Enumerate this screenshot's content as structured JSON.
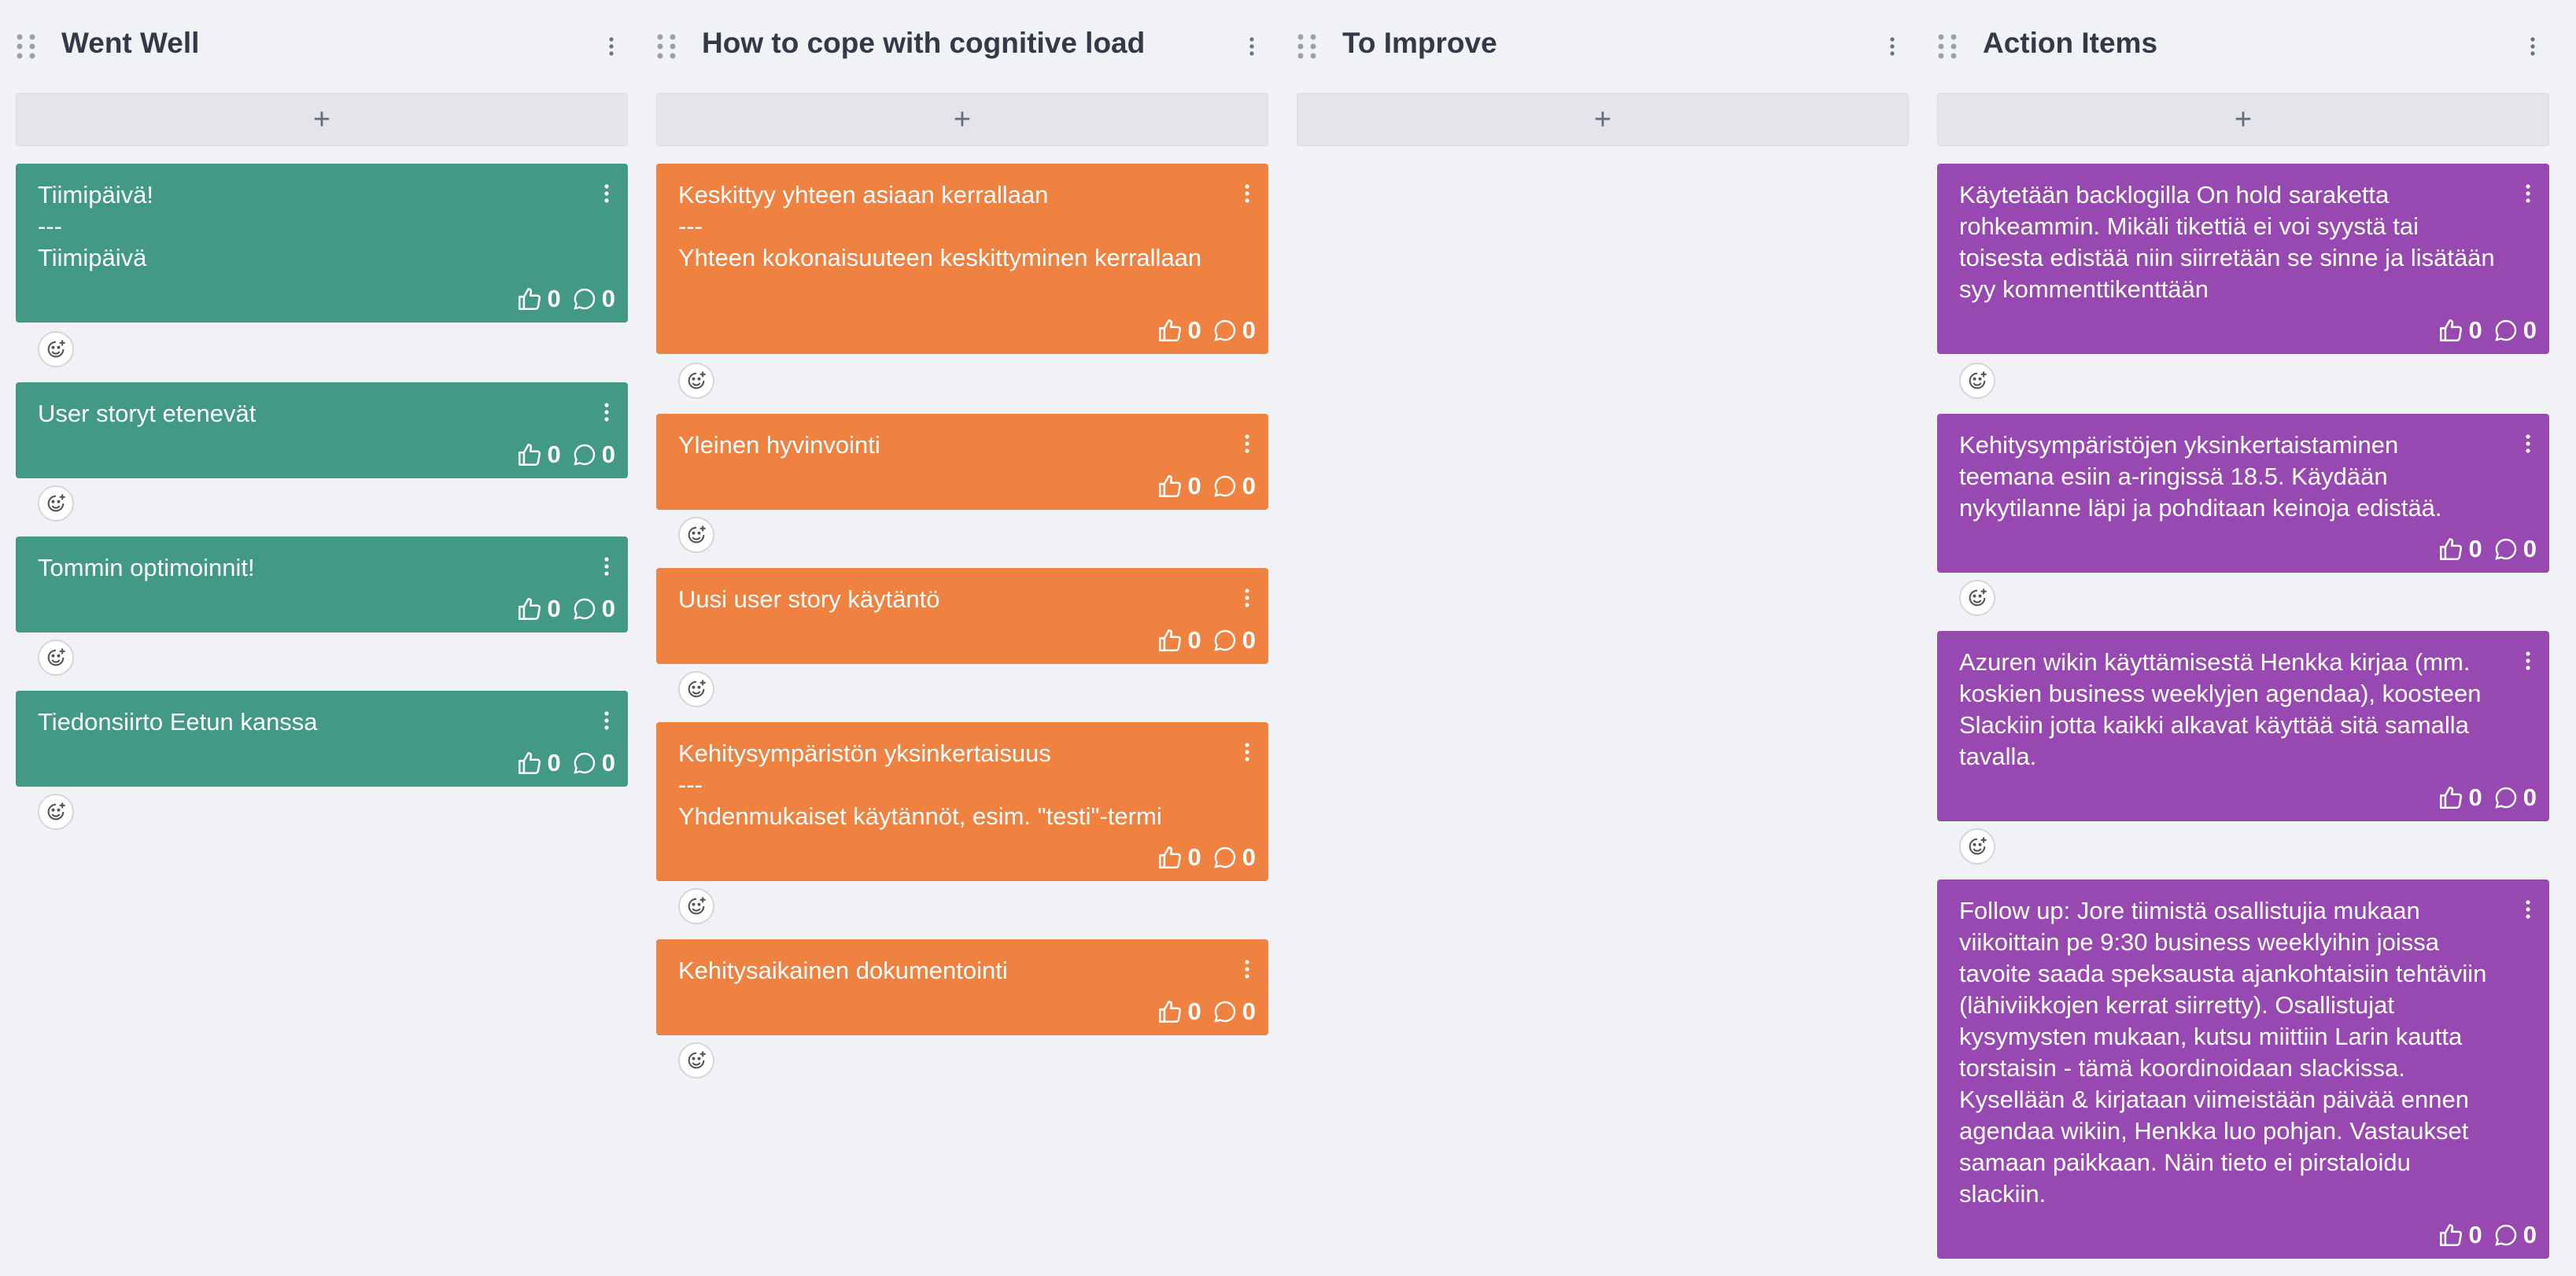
{
  "columns": [
    {
      "title": "Went Well",
      "add_label": "+",
      "color": "#419986",
      "cards": [
        {
          "text": "Tiimipäivä!\n---\nTiimipäivä",
          "likes": "0",
          "comments": "0"
        },
        {
          "text": "User storyt etenevät",
          "likes": "0",
          "comments": "0"
        },
        {
          "text": "Tommin optimoinnit!",
          "likes": "0",
          "comments": "0"
        },
        {
          "text": "Tiedonsiirto Eetun kanssa",
          "likes": "0",
          "comments": "0"
        }
      ]
    },
    {
      "title": "How to cope with cognitive load",
      "add_label": "+",
      "color": "#ef8141",
      "cards": [
        {
          "text": "Keskittyy yhteen asiaan kerrallaan\n---\nYhteen kokonaisuuteen keskittyminen kerrallaan",
          "likes": "0",
          "comments": "0"
        },
        {
          "text": "Yleinen hyvinvointi",
          "likes": "0",
          "comments": "0"
        },
        {
          "text": "Uusi user story käytäntö",
          "likes": "0",
          "comments": "0"
        },
        {
          "text": "Kehitysympäristön yksinkertaisuus\n---\nYhdenmukaiset käytännöt, esim. \"testi\"-termi",
          "likes": "0",
          "comments": "0"
        },
        {
          "text": "Kehitysaikainen dokumentointi",
          "likes": "0",
          "comments": "0"
        }
      ]
    },
    {
      "title": "To Improve",
      "add_label": "+",
      "color": "#9749b1",
      "cards": []
    },
    {
      "title": "Action Items",
      "add_label": "+",
      "color": "#9749b1",
      "cards": [
        {
          "text": "Käytetään backlogilla On hold saraketta rohkeammin. Mikäli tikettiä ei voi syystä tai toisesta edistää niin siirretään se sinne ja lisätään syy kommenttikenttään",
          "likes": "0",
          "comments": "0"
        },
        {
          "text": "Kehitysympäristöjen yksinkertaistaminen teemana esiin a-ringissä 18.5. Käydään nykytilanne läpi ja pohditaan keinoja edistää.",
          "likes": "0",
          "comments": "0"
        },
        {
          "text": "Azuren wikin käyttämisestä Henkka kirjaa (mm. koskien business weeklyjen agendaa), koosteen Slackiin jotta kaikki alkavat käyttää sitä samalla tavalla.",
          "likes": "0",
          "comments": "0"
        },
        {
          "text": "Follow up: Jore tiimistä osallistujia mukaan viikoittain pe 9:30 business weeklyihin joissa tavoite saada speksausta ajankohtaisiin tehtäviin (lähiviikkojen kerrat siirretty). Osallistujat kysymysten mukaan, kutsu miittiin Larin kautta torstaisin - tämä koordinoidaan slackissa. Kysellään & kirjataan viimeistään päivää ennen agendaa wikiin, Henkka luo pohjan. Vastaukset samaan paikkaan. Näin tieto ei pirstaloidu slackiin.",
          "likes": "0",
          "comments": "0"
        }
      ]
    }
  ]
}
